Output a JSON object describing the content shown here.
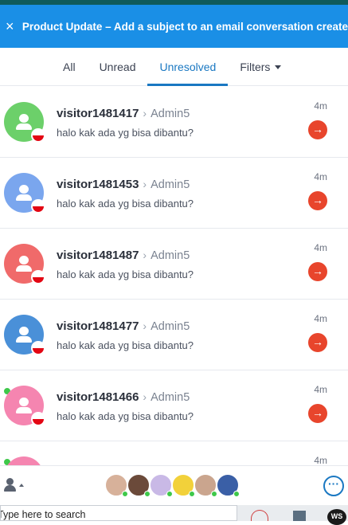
{
  "banner": {
    "close_glyph": "×",
    "text": "Product Update – Add a subject to an email conversation create"
  },
  "tabs": [
    {
      "label": "All"
    },
    {
      "label": "Unread"
    },
    {
      "label": "Unresolved"
    },
    {
      "label": "Filters"
    }
  ],
  "conversations": [
    {
      "visitor": "visitor1481417",
      "agent": "Admin5",
      "message": "halo kak ada yg bisa dibantu?",
      "time": "4m",
      "avatar_color": "#6cd06a",
      "online": false
    },
    {
      "visitor": "visitor1481453",
      "agent": "Admin5",
      "message": "halo kak ada yg bisa dibantu?",
      "time": "4m",
      "avatar_color": "#7aa6ee",
      "online": false
    },
    {
      "visitor": "visitor1481487",
      "agent": "Admin5",
      "message": "halo kak ada yg bisa dibantu?",
      "time": "4m",
      "avatar_color": "#f06a6a",
      "online": false
    },
    {
      "visitor": "visitor1481477",
      "agent": "Admin5",
      "message": "halo kak ada yg bisa dibantu?",
      "time": "4m",
      "avatar_color": "#4a90d8",
      "online": false
    },
    {
      "visitor": "visitor1481466",
      "agent": "Admin5",
      "message": "halo kak ada yg bisa dibantu?",
      "time": "4m",
      "avatar_color": "#f585b0",
      "online": true
    }
  ],
  "partial_row": {
    "time": "4m",
    "avatar_color": "#f585b0"
  },
  "icons": {
    "chevron": "›",
    "arrow": "→",
    "more": "···"
  },
  "team_avatars": [
    "#d7b19a",
    "#6b4a3a",
    "#c9b9e6",
    "#f2d13a",
    "#caa58e",
    "#3a5fa6"
  ],
  "taskbar": {
    "search_placeholder": "Type here to search",
    "ws_label": "WS"
  }
}
